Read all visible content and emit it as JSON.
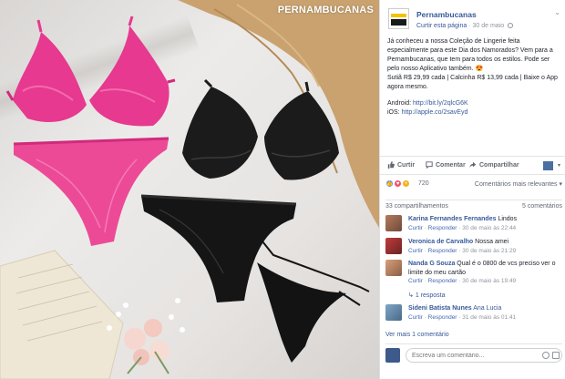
{
  "photo": {
    "watermark": "PERNAMBUCANAS"
  },
  "post": {
    "page_name": "Pernambucanas",
    "follow_label": "Curtir esta página",
    "date": "30 de maio",
    "text": "Já conheceu a nossa Coleção de Lingerie feita especialmente para este Dia dos Namorados? Vem para a Pernambucanas, que tem para todos os estilos. Pode ser pelo nosso Aplicativo também. 😍\nSutiã R$ 29,99 cada | Calcinha R$ 13,99 cada | Baixe o App agora mesmo.",
    "android_label": "Android:",
    "android_link": "http://bit.ly/2qlcG6K",
    "ios_label": "iOS:",
    "ios_link": "http://apple.co/2savEyd"
  },
  "actions": {
    "like": "Curtir",
    "comment": "Comentar",
    "share": "Compartilhar"
  },
  "reactions": {
    "count": "720",
    "sort": "Comentários mais relevantes ▾",
    "colors": {
      "like": "#5890ff",
      "love": "#f25268",
      "wow": "#f7b125"
    }
  },
  "stats": {
    "shares": "33 compartilhamentos",
    "comments": "5 comentários"
  },
  "comments": [
    {
      "name": "Karina Fernandes Fernandes",
      "text": "Lindos",
      "like": "Curtir",
      "reply": "Responder",
      "time": "30 de maio às 22:44"
    },
    {
      "name": "Veronica de Carvalho",
      "text": "Nossa amei",
      "like": "Curtir",
      "reply": "Responder",
      "time": "30 de maio às 21:29"
    },
    {
      "name": "Nanda G Souza",
      "text": "Qual é o 0800 de vcs preciso ver o limite do meu cartão",
      "like": "Curtir",
      "reply": "Responder",
      "time": "30 de maio às 19:49"
    },
    {
      "name": "Sideni Batista Nunes",
      "text": "Ana Lucia",
      "like": "Curtir",
      "reply": "Responder",
      "time": "31 de maio às 01:41"
    }
  ],
  "reply_link": "1 resposta",
  "more_comments": "Ver mais 1 comentário",
  "composer": {
    "placeholder": "Escreva um comentário..."
  }
}
